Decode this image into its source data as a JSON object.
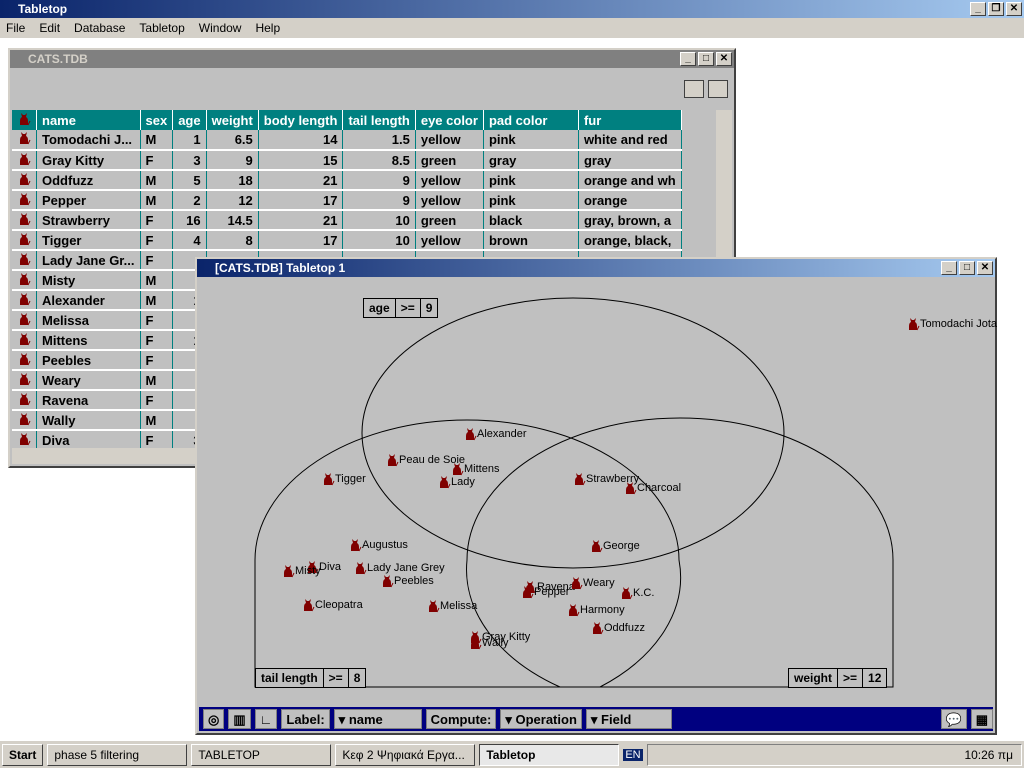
{
  "app": {
    "title": "Tabletop",
    "menu": [
      "File",
      "Edit",
      "Database",
      "Tabletop",
      "Window",
      "Help"
    ]
  },
  "db_window": {
    "title": "CATS.TDB",
    "columns": [
      "name",
      "sex",
      "age",
      "weight",
      "body length",
      "tail length",
      "eye color",
      "pad color",
      "fur"
    ],
    "rows": [
      [
        "Tomodachi J...",
        "M",
        "1",
        "6.5",
        "14",
        "1.5",
        "yellow",
        "pink",
        "white and red"
      ],
      [
        "Gray Kitty",
        "F",
        "3",
        "9",
        "15",
        "8.5",
        "green",
        "gray",
        "gray"
      ],
      [
        "Oddfuzz",
        "M",
        "5",
        "18",
        "21",
        "9",
        "yellow",
        "pink",
        "orange and wh"
      ],
      [
        "Pepper",
        "M",
        "2",
        "12",
        "17",
        "9",
        "yellow",
        "pink",
        "orange"
      ],
      [
        "Strawberry",
        "F",
        "16",
        "14.5",
        "21",
        "10",
        "green",
        "black",
        "gray, brown, a"
      ],
      [
        "Tigger",
        "F",
        "4",
        "8",
        "17",
        "10",
        "yellow",
        "brown",
        "orange, black,"
      ],
      [
        "Lady Jane Gr...",
        "F",
        "",
        "",
        "",
        "",
        "",
        "",
        ""
      ],
      [
        "Misty",
        "M",
        "",
        "",
        "",
        "",
        "",
        "",
        ""
      ],
      [
        "Alexander",
        "M",
        "1",
        "",
        "",
        "",
        "",
        "",
        ""
      ],
      [
        "Melissa",
        "F",
        "",
        "",
        "",
        "",
        "",
        "",
        ""
      ],
      [
        "Mittens",
        "F",
        "1",
        "",
        "",
        "",
        "",
        "",
        ""
      ],
      [
        "Peebles",
        "F",
        "",
        "",
        "",
        "",
        "",
        "",
        ""
      ],
      [
        "Weary",
        "M",
        "",
        "",
        "",
        "",
        "",
        "",
        ""
      ],
      [
        "Ravena",
        "F",
        "",
        "",
        "",
        "",
        "",
        "",
        ""
      ],
      [
        "Wally",
        "M",
        "",
        "",
        "",
        "",
        "",
        "",
        ""
      ],
      [
        "Diva",
        "F",
        "3",
        "",
        "",
        "",
        "",
        "",
        ""
      ]
    ]
  },
  "plot_window": {
    "title": "[CATS.TDB] Tabletop 1",
    "filters": {
      "age": [
        "age",
        ">=",
        "9"
      ],
      "tail": [
        "tail length",
        ">=",
        "8"
      ],
      "weight": [
        "weight",
        ">=",
        "12"
      ]
    },
    "points": [
      "Tomodachi Jota",
      "Alexander",
      "Peau de Soie",
      "Mittens",
      "Lady",
      "Tigger",
      "Strawberry",
      "Charcoal",
      "George",
      "Augustus",
      "Diva",
      "Misty",
      "Lady Jane Grey",
      "Peebles",
      "Cleopatra",
      "Melissa",
      "Ravena",
      "Pepper",
      "Weary",
      "K.C.",
      "Harmony",
      "Oddfuzz",
      "Gray Kitty",
      "Wally"
    ],
    "bottom": {
      "label_caption": "Label:",
      "label_value": "name",
      "compute_caption": "Compute:",
      "operation": "Operation",
      "field": "Field"
    }
  },
  "taskbar": {
    "start": "Start",
    "items": [
      "phase 5 filtering",
      "TABLETOP",
      "Κεφ 2 Ψηφιακά Εργα...",
      "Tabletop"
    ],
    "lang": "EN",
    "clock": "10:26 πμ"
  },
  "colors": {
    "header": "#008080",
    "cat": "#800000",
    "title_active": "#0a246a"
  }
}
